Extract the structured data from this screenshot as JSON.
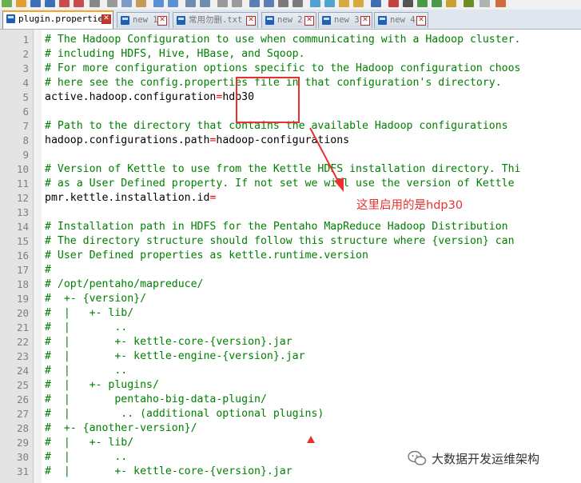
{
  "tabs": [
    {
      "label": "plugin.properties",
      "active": true
    },
    {
      "label": "new 1",
      "active": false
    },
    {
      "label": "常用勿删.txt",
      "active": false
    },
    {
      "label": "new 2",
      "active": false
    },
    {
      "label": "new 3",
      "active": false
    },
    {
      "label": "new 4",
      "active": false
    }
  ],
  "lines": [
    {
      "n": "1",
      "type": "comment",
      "text": "# The Hadoop Configuration to use when communicating with a Hadoop cluster."
    },
    {
      "n": "2",
      "type": "comment",
      "text": "# including HDFS, Hive, HBase, and Sqoop."
    },
    {
      "n": "3",
      "type": "comment",
      "text": "# For more configuration options specific to the Hadoop configuration choos"
    },
    {
      "n": "4",
      "type": "comment",
      "text": "# here see the config.properties file in that configuration's directory."
    },
    {
      "n": "5",
      "type": "prop",
      "key": "active.hadoop.configuration",
      "eq": "=",
      "value": "hdp30"
    },
    {
      "n": "6",
      "type": "blank",
      "text": ""
    },
    {
      "n": "7",
      "type": "comment",
      "text": "# Path to the directory that contains the available Hadoop configurations"
    },
    {
      "n": "8",
      "type": "prop",
      "key": "hadoop.configurations.path",
      "eq": "=",
      "value": "hadoop-configurations"
    },
    {
      "n": "9",
      "type": "blank",
      "text": ""
    },
    {
      "n": "10",
      "type": "comment",
      "text": "# Version of Kettle to use from the Kettle HDFS installation directory. Thi"
    },
    {
      "n": "11",
      "type": "comment",
      "text": "# as a User Defined property. If not set we will use the version of Kettle"
    },
    {
      "n": "12",
      "type": "prop",
      "key": "pmr.kettle.installation.id",
      "eq": "=",
      "value": ""
    },
    {
      "n": "13",
      "type": "blank",
      "text": ""
    },
    {
      "n": "14",
      "type": "comment",
      "text": "# Installation path in HDFS for the Pentaho MapReduce Hadoop Distribution"
    },
    {
      "n": "15",
      "type": "comment",
      "text": "# The directory structure should follow this structure where {version} can"
    },
    {
      "n": "16",
      "type": "comment",
      "text": "# User Defined properties as kettle.runtime.version"
    },
    {
      "n": "17",
      "type": "comment",
      "text": "#"
    },
    {
      "n": "18",
      "type": "comment",
      "text": "# /opt/pentaho/mapreduce/"
    },
    {
      "n": "19",
      "type": "comment",
      "text": "#  +- {version}/"
    },
    {
      "n": "20",
      "type": "comment",
      "text": "#  |   +- lib/"
    },
    {
      "n": "21",
      "type": "comment",
      "text": "#  |       .."
    },
    {
      "n": "22",
      "type": "comment",
      "text": "#  |       +- kettle-core-{version}.jar"
    },
    {
      "n": "23",
      "type": "comment",
      "text": "#  |       +- kettle-engine-{version}.jar"
    },
    {
      "n": "24",
      "type": "comment",
      "text": "#  |       .."
    },
    {
      "n": "25",
      "type": "comment",
      "text": "#  |   +- plugins/"
    },
    {
      "n": "26",
      "type": "comment",
      "text": "#  |       pentaho-big-data-plugin/"
    },
    {
      "n": "27",
      "type": "comment",
      "text": "#  |        .. (additional optional plugins)"
    },
    {
      "n": "28",
      "type": "comment",
      "text": "#  +- {another-version}/"
    },
    {
      "n": "29",
      "type": "comment",
      "text": "#  |   +- lib/"
    },
    {
      "n": "30",
      "type": "comment",
      "text": "#  |       .."
    },
    {
      "n": "31",
      "type": "comment",
      "text": "#  |       +- kettle-core-{version}.jar"
    }
  ],
  "annotation": {
    "note": "这里启用的是hdp30",
    "color": "#e8302f"
  },
  "watermark": {
    "text": "大数据开发运维架构"
  },
  "colors": {
    "comment": "#008000",
    "equals": "#ff0000",
    "gutter": "#e4e4e4",
    "line_number": "#808080"
  }
}
